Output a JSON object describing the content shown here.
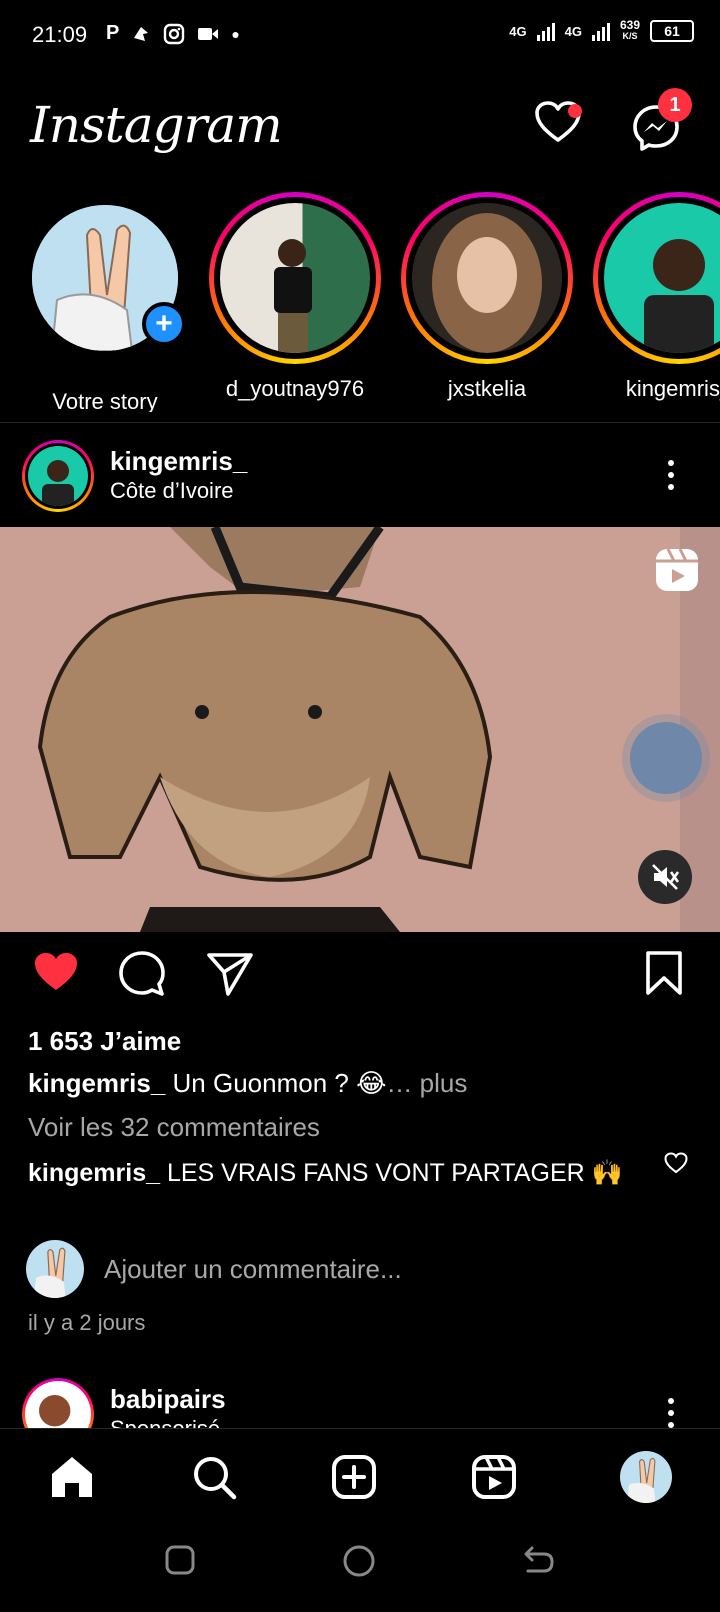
{
  "status_bar": {
    "time": "21:09",
    "net1": "4G",
    "net2": "4G",
    "speed_value": "639",
    "speed_unit": "K/S",
    "battery": "61"
  },
  "header": {
    "logo": "Instagram",
    "messages_badge": "1"
  },
  "stories": [
    {
      "name": "Votre story",
      "own": true
    },
    {
      "name": "d_youtnay976",
      "own": false
    },
    {
      "name": "jxstkelia",
      "own": false
    },
    {
      "name": "kingemris_",
      "own": false
    }
  ],
  "post": {
    "username": "kingemris_",
    "location": "Côte d’Ivoire",
    "likes": "1 653 J’aime",
    "caption_user": "kingemris_",
    "caption_text": " Un Guonmon ? 😂",
    "caption_more": "… plus",
    "view_comments": "Voir les 32 commentaires",
    "comment_user": "kingemris_",
    "comment_text": " LES VRAIS FANS VONT PARTAGER 🙌",
    "add_comment_placeholder": "Ajouter un commentaire...",
    "time_ago": "il y a 2 jours",
    "liked": true
  },
  "next_post": {
    "username": "babipairs",
    "subtitle": "Sponsorisé"
  },
  "colors": {
    "background": "#000000",
    "like_red": "#ff3040",
    "secondary_text": "#a8a8a8",
    "story_blue": "#1e90ff"
  },
  "bottom_nav": [
    "home-icon",
    "search-icon",
    "create-icon",
    "reels-icon",
    "profile-avatar"
  ]
}
